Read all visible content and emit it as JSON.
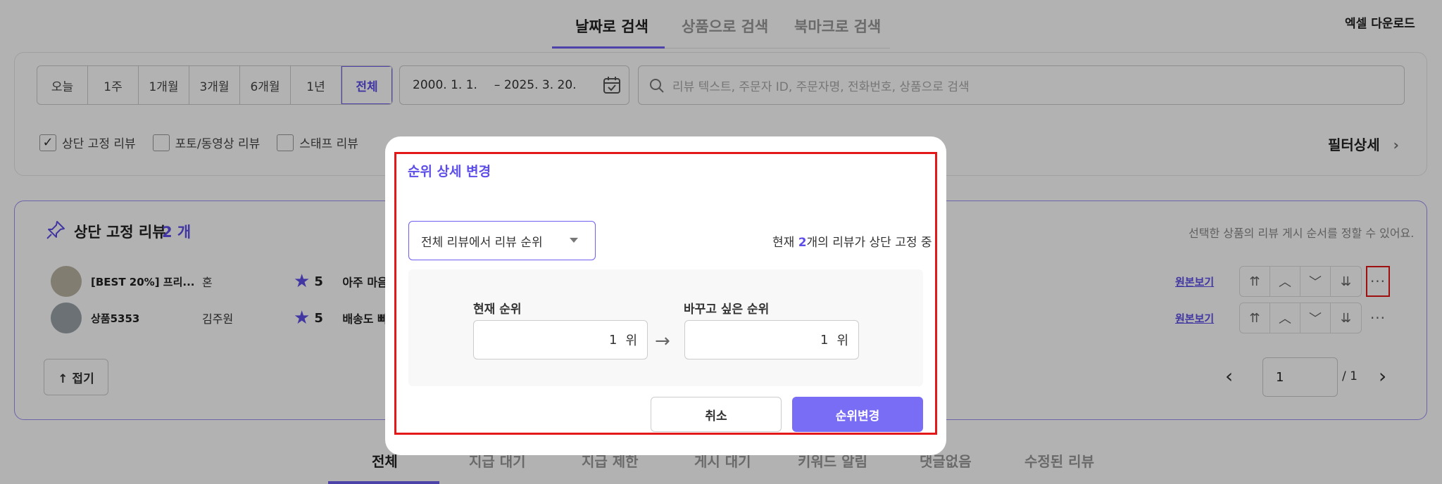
{
  "top_tabs": {
    "date": "날짜로 검색",
    "product": "상품으로 검색",
    "bookmark": "북마크로 검색"
  },
  "excel_download": "엑셀 다운로드",
  "period": {
    "today": "오늘",
    "w1": "1주",
    "m1": "1개월",
    "m3": "3개월",
    "m6": "6개월",
    "y1": "1년",
    "all": "전체"
  },
  "date_range": {
    "start": "2000. 1. 1.",
    "end": "– 2025. 3. 20."
  },
  "search": {
    "placeholder": "리뷰 텍스트, 주문자 ID, 주문자명, 전화번호, 상품으로 검색"
  },
  "filters": {
    "pinned": "상단 고정 리뷰",
    "photo": "포토/동영상 리뷰",
    "staff": "스태프 리뷰",
    "check_mark": "✓"
  },
  "filter_detail": "필터상세",
  "filter_detail_chevron": "›",
  "pinned": {
    "title": "상단 고정 리뷰",
    "count": "2 개",
    "hint": "선택한 상품의 리뷰 게시 순서를 정할 수 있어요.",
    "rows": [
      {
        "product": "[BEST 20%] 프리...",
        "author": "혼",
        "score": "5",
        "text": "아주 마음",
        "origin": "원본보기"
      },
      {
        "product": "상품5353",
        "author": "김주원",
        "score": "5",
        "text": "배송도 빠",
        "origin": "원본보기"
      }
    ],
    "star": "★",
    "order_buttons": {
      "top": "⇈",
      "up": "︿",
      "down": "﹀",
      "bottom": "⇊"
    },
    "more": "···",
    "fold": "↑ 접기"
  },
  "pagination": {
    "prev": "‹",
    "current": "1",
    "total": "/ 1",
    "next": "›"
  },
  "bottom_tabs": {
    "all": "전체",
    "t2": "지급 대기",
    "t3": "지급 제한",
    "t4": "게시 대기",
    "t5": "키워드 알림",
    "t6": "댓글없음",
    "t7": "수정된 리뷰"
  },
  "modal": {
    "title": "순위 상세 변경",
    "dropdown_value": "전체 리뷰에서 리뷰 순위",
    "status_prefix": "현재 ",
    "status_count": "2",
    "status_suffix": "개의 리뷰가 상단 고정 중",
    "current_rank_label": "현재 순위",
    "current_rank_value": "1",
    "target_rank_label": "바꾸고 싶은 순위",
    "target_rank_value": "1",
    "rank_unit": "위",
    "arrow": "→",
    "cancel": "취소",
    "confirm": "순위변경"
  },
  "colors": {
    "accent": "#6e5ff0",
    "highlight": "#e31818"
  }
}
